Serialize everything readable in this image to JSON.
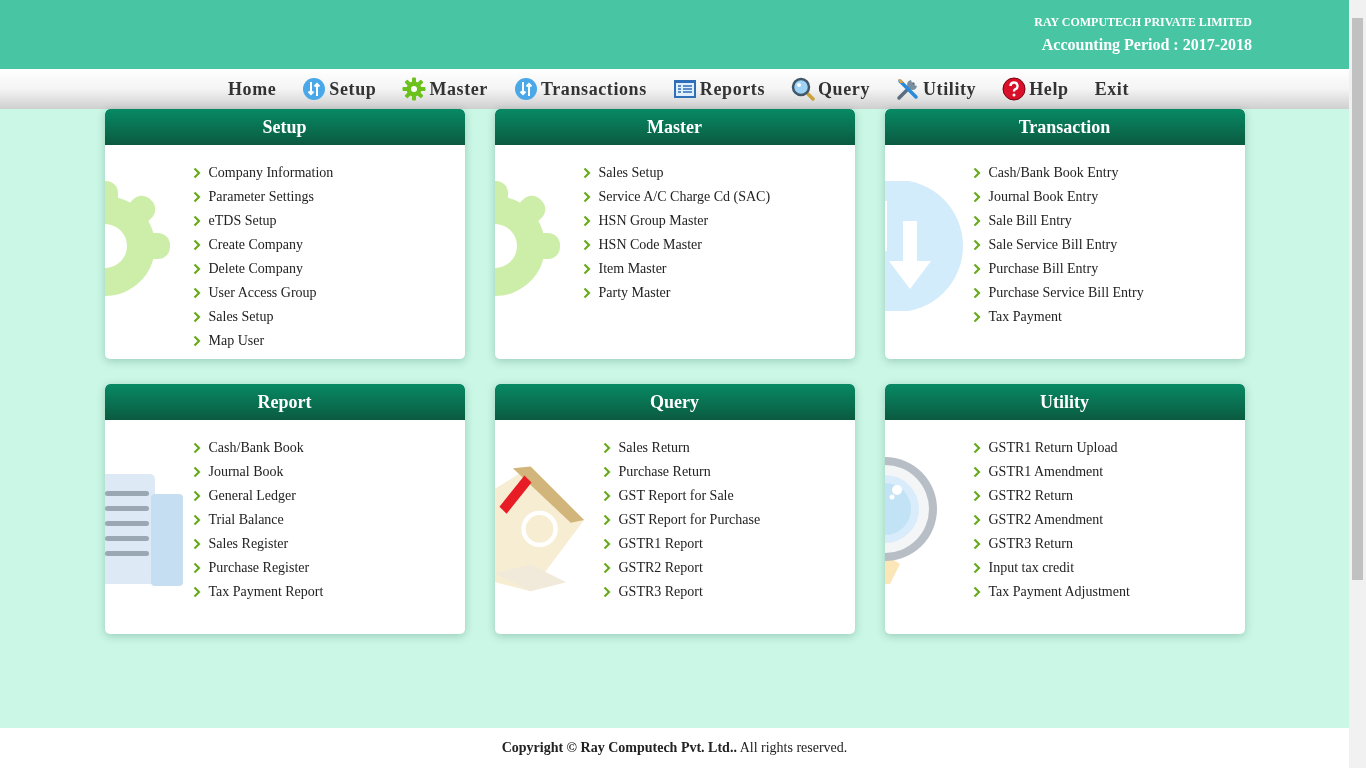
{
  "header": {
    "company": "RAY COMPUTECH PRIVATE LIMITED",
    "period": "Accounting Period : 2017-2018"
  },
  "nav": [
    {
      "label": "Home",
      "kind": "text"
    },
    {
      "label": "Setup",
      "kind": "sync"
    },
    {
      "label": "Master",
      "kind": "gear"
    },
    {
      "label": "Transactions",
      "kind": "sync"
    },
    {
      "label": "Reports",
      "kind": "report"
    },
    {
      "label": "Query",
      "kind": "search"
    },
    {
      "label": "Utility",
      "kind": "tools"
    },
    {
      "label": "Help",
      "kind": "help"
    },
    {
      "label": "Exit",
      "kind": "text"
    }
  ],
  "cards": [
    {
      "title": "Setup",
      "kind": "gear",
      "items": [
        "Company Information",
        "Parameter Settings",
        "eTDS Setup",
        "Create Company",
        "Delete Company",
        "User Access Group",
        "Sales Setup",
        "Map User"
      ]
    },
    {
      "title": "Master",
      "kind": "gear",
      "items": [
        "Sales Setup",
        "Service A/C Charge Cd (SAC)",
        "HSN Group Master",
        "HSN Code Master",
        "Item Master",
        "Party Master"
      ]
    },
    {
      "title": "Transaction",
      "kind": "arrow",
      "items": [
        "Cash/Bank Book Entry",
        "Journal Book Entry",
        "Sale Bill Entry",
        "Sale Service Bill Entry",
        "Purchase Bill Entry",
        "Purchase Service Bill Entry",
        "Tax Payment"
      ]
    },
    {
      "title": "Report",
      "kind": "document",
      "items": [
        "Cash/Bank Book",
        "Journal Book",
        "General Ledger",
        "Trial Balance",
        "Sales Register",
        "Purchase Register",
        "Tax Payment Report"
      ]
    },
    {
      "title": "Query",
      "kind": "book",
      "items": [
        "Sales Return",
        "Purchase Return",
        "GST Report for Sale",
        "GST Report for Purchase",
        "GSTR1 Report",
        "GSTR2 Report",
        "GSTR3 Report"
      ]
    },
    {
      "title": "Utility",
      "kind": "magnifier",
      "items": [
        "GSTR1 Return Upload",
        "GSTR1 Amendment",
        "GSTR2 Return",
        "GSTR2 Amendment",
        "GSTR3 Return",
        "Input tax credit",
        "Tax Payment Adjustment"
      ]
    }
  ],
  "footer": "**Copyright © Ray Computech Pvt. Ltd..** All rights reserved."
}
